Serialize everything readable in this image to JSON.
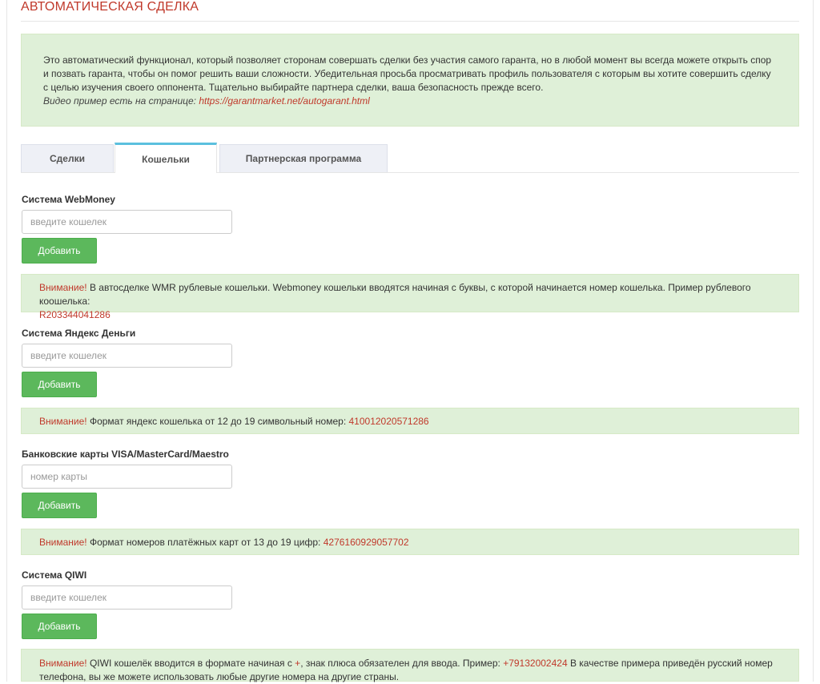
{
  "page": {
    "title": "АВТОМАТИЧЕСКАЯ СДЕЛКА"
  },
  "intro": {
    "text": "Это автоматический функционал, который позволяет сторонам совершать сделки без участия самого гаранта, но в любой момент вы всегда можете открыть спор и позвать гаранта, чтобы он помог решить ваши сложности. Убедительная просьба просматривать профиль пользователя с которым вы хотите совершить сделку с целью изучения своего оппонента. Тщательно выбирайте партнера сделки, ваша безопасность прежде всего.",
    "video_prefix": "Видео пример есть на странице:",
    "video_link": "https://garantmarket.net/autogarant.html"
  },
  "tabs": [
    {
      "label": "Сделки",
      "active": false
    },
    {
      "label": "Кошельки",
      "active": true
    },
    {
      "label": "Партнерская программа",
      "active": false
    }
  ],
  "sections": [
    {
      "label": "Система WebMoney",
      "placeholder": "введите кошелек",
      "button": "Добавить",
      "warn": "Внимание!",
      "notice": " В автосделке WMR рублевые кошельки. Webmoney кошельки вводятся начиная с буквы, с которой начинается номер кошелька. Пример рублевого коошелька:",
      "example": "R203344041286"
    },
    {
      "label": "Система Яндекс Деньги",
      "placeholder": "введите кошелек",
      "button": "Добавить",
      "warn": "Внимание!",
      "notice": " Формат яндекс кошелька от 12 до 19 символьный номер: ",
      "example": "410012020571286"
    },
    {
      "label": "Банковские карты VISA/MasterCard/Maestro",
      "placeholder": "номер карты",
      "button": "Добавить",
      "warn": "Внимание!",
      "notice": " Формат номеров платёжных карт от 13 до 19 цифр: ",
      "example": "4276160929057702"
    },
    {
      "label": "Система QIWI",
      "placeholder": "введите кошелек",
      "button": "Добавить",
      "warn": "Внимание!",
      "notice_a": " QIWI кошелёк вводится в формате начиная с ",
      "plus": "+",
      "notice_b": ", знак плюса обязателен для ввода. Пример: ",
      "example": "+79132002424",
      "notice_c": " В качестве примера приведён русский номер телефона, вы же можете использовать любые другие номера на другие страны."
    }
  ]
}
